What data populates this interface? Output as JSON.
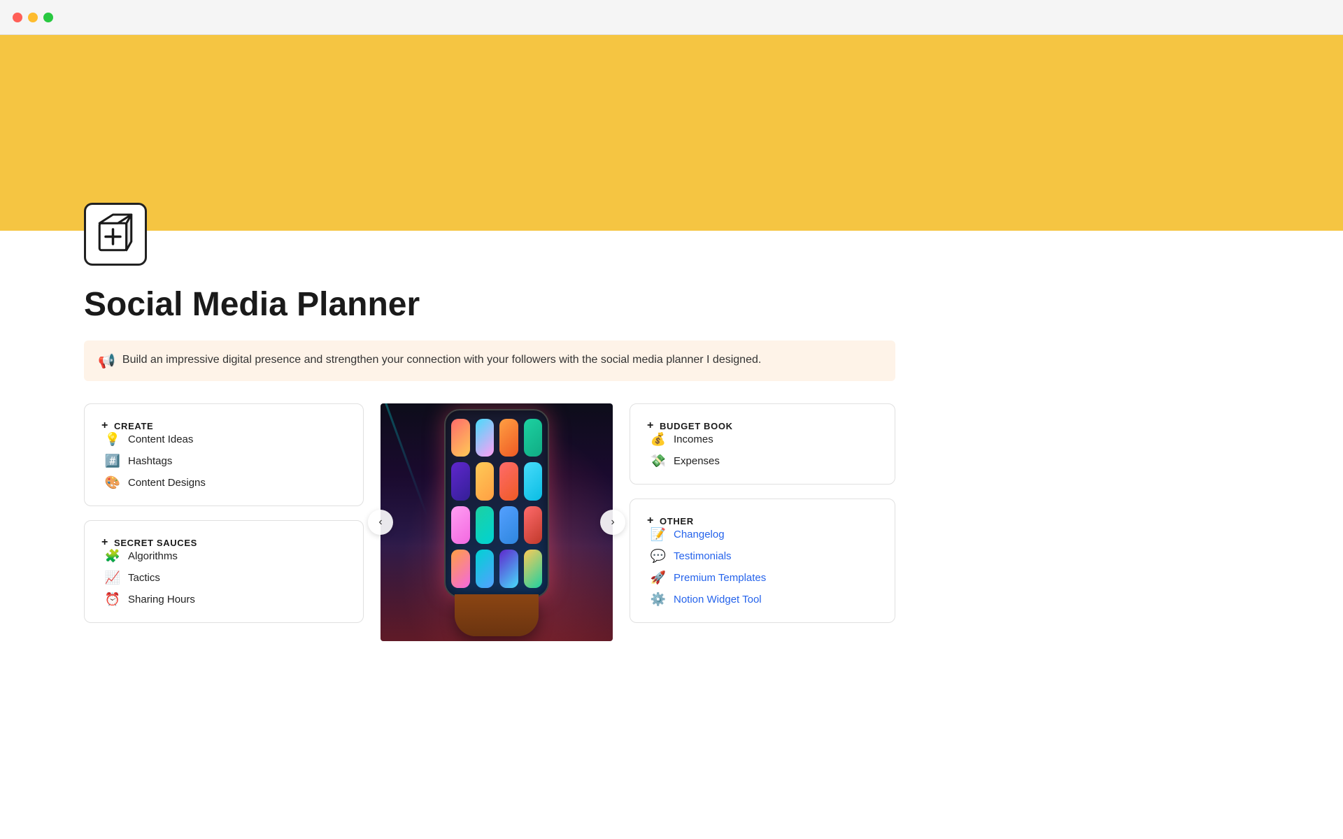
{
  "titlebar": {
    "traffic_lights": [
      "red",
      "yellow",
      "green"
    ]
  },
  "cover": {
    "background_color": "#f5c542"
  },
  "page": {
    "title": "Social Media Planner",
    "callout": {
      "icon": "📢",
      "text": "Build an impressive digital presence and strengthen your connection with your followers with the social media planner I designed."
    }
  },
  "create_card": {
    "header": "CREATE",
    "items": [
      {
        "emoji": "💡",
        "label": "Content Ideas"
      },
      {
        "emoji": "#️⃣",
        "label": "Hashtags"
      },
      {
        "emoji": "🎨",
        "label": "Content Designs"
      }
    ]
  },
  "secret_sauces_card": {
    "header": "SECRET SAUCES",
    "items": [
      {
        "emoji": "🧩",
        "label": "Algorithms"
      },
      {
        "emoji": "📈",
        "label": "Tactics"
      },
      {
        "emoji": "⏰",
        "label": "Sharing Hours"
      }
    ]
  },
  "budget_book_card": {
    "header": "BUDGET BOOK",
    "items": [
      {
        "emoji": "💰",
        "label": "Incomes"
      },
      {
        "emoji": "💸",
        "label": "Expenses"
      }
    ]
  },
  "other_card": {
    "header": "OTHER",
    "items": [
      {
        "emoji": "📝",
        "label": "Changelog"
      },
      {
        "emoji": "💬",
        "label": "Testimonials"
      },
      {
        "emoji": "🚀",
        "label": "Premium Templates"
      },
      {
        "emoji": "⚙️",
        "label": "Notion Widget Tool"
      }
    ]
  },
  "carousel": {
    "prev_label": "‹",
    "next_label": "›"
  }
}
